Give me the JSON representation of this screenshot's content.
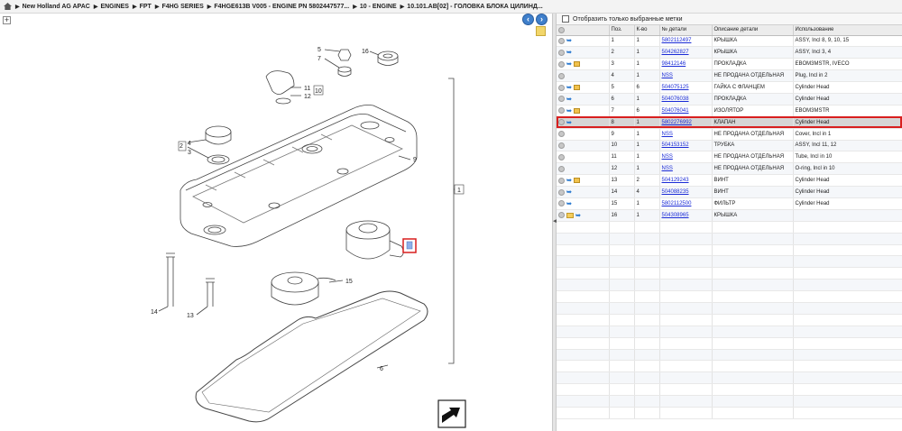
{
  "breadcrumb": [
    "New Holland AG APAC",
    "ENGINES",
    "FPT",
    "F4HG SERIES",
    "F4HGE613B V005 - ENGINE PN 5802447577...",
    "10 - ENGINE",
    "10.101.AB[02] - ГОЛОВКА БЛОКА ЦИЛИНД..."
  ],
  "filter_label": "Отобразить только выбранные метки",
  "columns": [
    "",
    "Поз.",
    "К-во",
    "№ детали",
    "Описание детали",
    "Использование"
  ],
  "rows": [
    {
      "pos": "1",
      "qty": "1",
      "part": "5802112497",
      "desc": "КРЫШКА",
      "usage": "ASSY, Incl 8, 9, 10, 15",
      "icons": [
        "circle",
        "arrow"
      ]
    },
    {
      "pos": "2",
      "qty": "1",
      "part": "504262827",
      "desc": "КРЫШКА",
      "usage": "ASSY, Incl 3, 4",
      "icons": [
        "circle",
        "arrow"
      ]
    },
    {
      "pos": "3",
      "qty": "1",
      "part": "98412146",
      "desc": "ПРОКЛАДКА",
      "usage": "EBOM3MSTR, IVECO",
      "icons": [
        "circle",
        "arrow",
        "box"
      ]
    },
    {
      "pos": "4",
      "qty": "1",
      "part": "NSS",
      "desc": "НЕ ПРОДАНА ОТДЕЛЬНАЯ",
      "usage": "Plug, Incl in 2",
      "icons": [
        "circle"
      ]
    },
    {
      "pos": "5",
      "qty": "6",
      "part": "504075125",
      "desc": "ГАЙКА С ФЛАНЦЕМ",
      "usage": "Cylinder Head",
      "icons": [
        "circle",
        "arrow",
        "box"
      ]
    },
    {
      "pos": "6",
      "qty": "1",
      "part": "504076038",
      "desc": "ПРОКЛАДКА",
      "usage": "Cylinder Head",
      "icons": [
        "circle",
        "arrow"
      ]
    },
    {
      "pos": "7",
      "qty": "6",
      "part": "504076041",
      "desc": "ИЗОЛЯТОР",
      "usage": "EBOM3MSTR",
      "icons": [
        "circle",
        "arrow",
        "box"
      ]
    },
    {
      "pos": "8",
      "qty": "1",
      "part": "5802276992",
      "desc": "КЛАПАН",
      "usage": "Cylinder Head",
      "icons": [
        "circle",
        "arrow"
      ],
      "selected": true
    },
    {
      "pos": "9",
      "qty": "1",
      "part": "NSS",
      "desc": "НЕ ПРОДАНА ОТДЕЛЬНАЯ",
      "usage": "Cover, Incl in 1",
      "icons": [
        "circle"
      ]
    },
    {
      "pos": "10",
      "qty": "1",
      "part": "504153152",
      "desc": "ТРУБКА",
      "usage": "ASSY, Incl 11, 12",
      "icons": [
        "circle"
      ]
    },
    {
      "pos": "11",
      "qty": "1",
      "part": "NSS",
      "desc": "НЕ ПРОДАНА ОТДЕЛЬНАЯ",
      "usage": "Tube, Incl in 10",
      "icons": [
        "circle"
      ]
    },
    {
      "pos": "12",
      "qty": "1",
      "part": "NSS",
      "desc": "НЕ ПРОДАНА ОТДЕЛЬНАЯ",
      "usage": "O-ring, Incl in 10",
      "icons": [
        "circle"
      ]
    },
    {
      "pos": "13",
      "qty": "2",
      "part": "504129243",
      "desc": "ВИНТ",
      "usage": "Cylinder Head",
      "icons": [
        "circle",
        "arrow",
        "box"
      ]
    },
    {
      "pos": "14",
      "qty": "4",
      "part": "504088235",
      "desc": "ВИНТ",
      "usage": "Cylinder Head",
      "icons": [
        "circle",
        "arrow"
      ]
    },
    {
      "pos": "15",
      "qty": "1",
      "part": "5802112500",
      "desc": "ФИЛЬТР",
      "usage": "Cylinder Head",
      "icons": [
        "circle",
        "arrow"
      ]
    },
    {
      "pos": "16",
      "qty": "1",
      "part": "504308965",
      "desc": "КРЫШКА",
      "usage": "",
      "icons": [
        "circle",
        "folder",
        "arrow"
      ]
    }
  ],
  "empty_rows": 17,
  "diagram_callouts": [
    "1",
    "2",
    "3",
    "4",
    "5",
    "6",
    "7",
    "8",
    "9",
    "10",
    "11",
    "12",
    "13",
    "14",
    "15",
    "16"
  ],
  "colors": {
    "selected_outline": "#d81f1f",
    "link": "#1a2bd6",
    "nav_blue": "#3f7fcb"
  }
}
